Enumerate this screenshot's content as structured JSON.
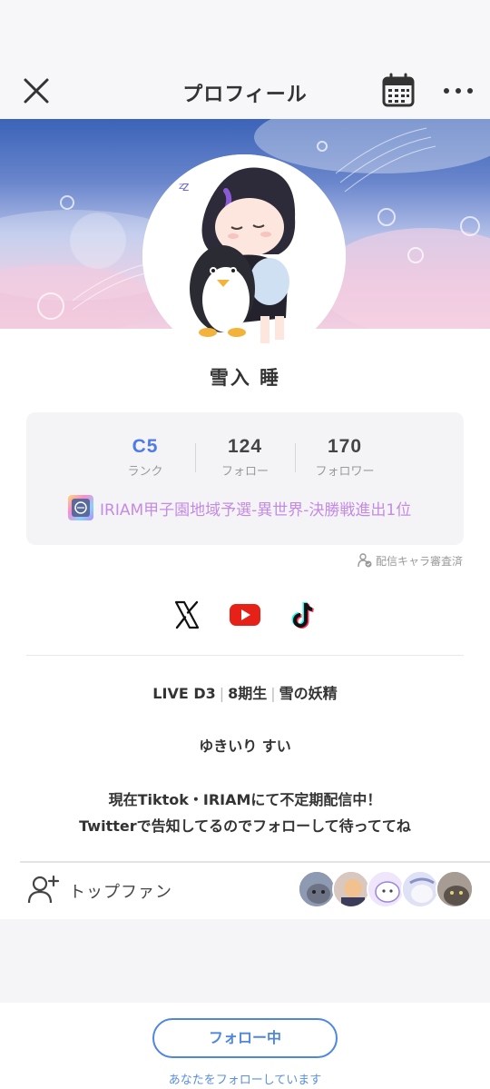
{
  "header": {
    "title": "プロフィール"
  },
  "profile": {
    "name": "雪入 睡"
  },
  "stats": {
    "rank_value": "C5",
    "rank_label": "ランク",
    "following_value": "124",
    "following_label": "フォロー",
    "followers_value": "170",
    "followers_label": "フォロワー"
  },
  "award": {
    "text": "IRIAM甲子園地域予選-異世界-決勝戦進出1位"
  },
  "verified": {
    "text": "配信キャラ審査済"
  },
  "bio": {
    "tag1": "LIVE D3",
    "tag2": "8期生",
    "tag3": "雪の妖精",
    "line2": "ゆきいり すい",
    "line3": "現在Tiktok・IRIAMにて不定期配信中！",
    "line4": "Twitterで告知してるのでフォローして待っててね"
  },
  "fans": {
    "label": "トップファン",
    "avatars": [
      "fan-1",
      "fan-2",
      "fan-3",
      "fan-4",
      "fan-5"
    ]
  },
  "bottom": {
    "follow_label": "フォロー中",
    "follow_note": "あなたをフォローしています"
  },
  "colors": {
    "accent": "#4f86e0",
    "rank": "#4f7be6",
    "award": "#c58be3",
    "youtube": "#e62117"
  },
  "icons": [
    "close-icon",
    "calendar-icon",
    "more-icon",
    "x-icon",
    "youtube-icon",
    "tiktok-icon",
    "add-user-icon",
    "verified-icon",
    "award-badge-icon"
  ]
}
